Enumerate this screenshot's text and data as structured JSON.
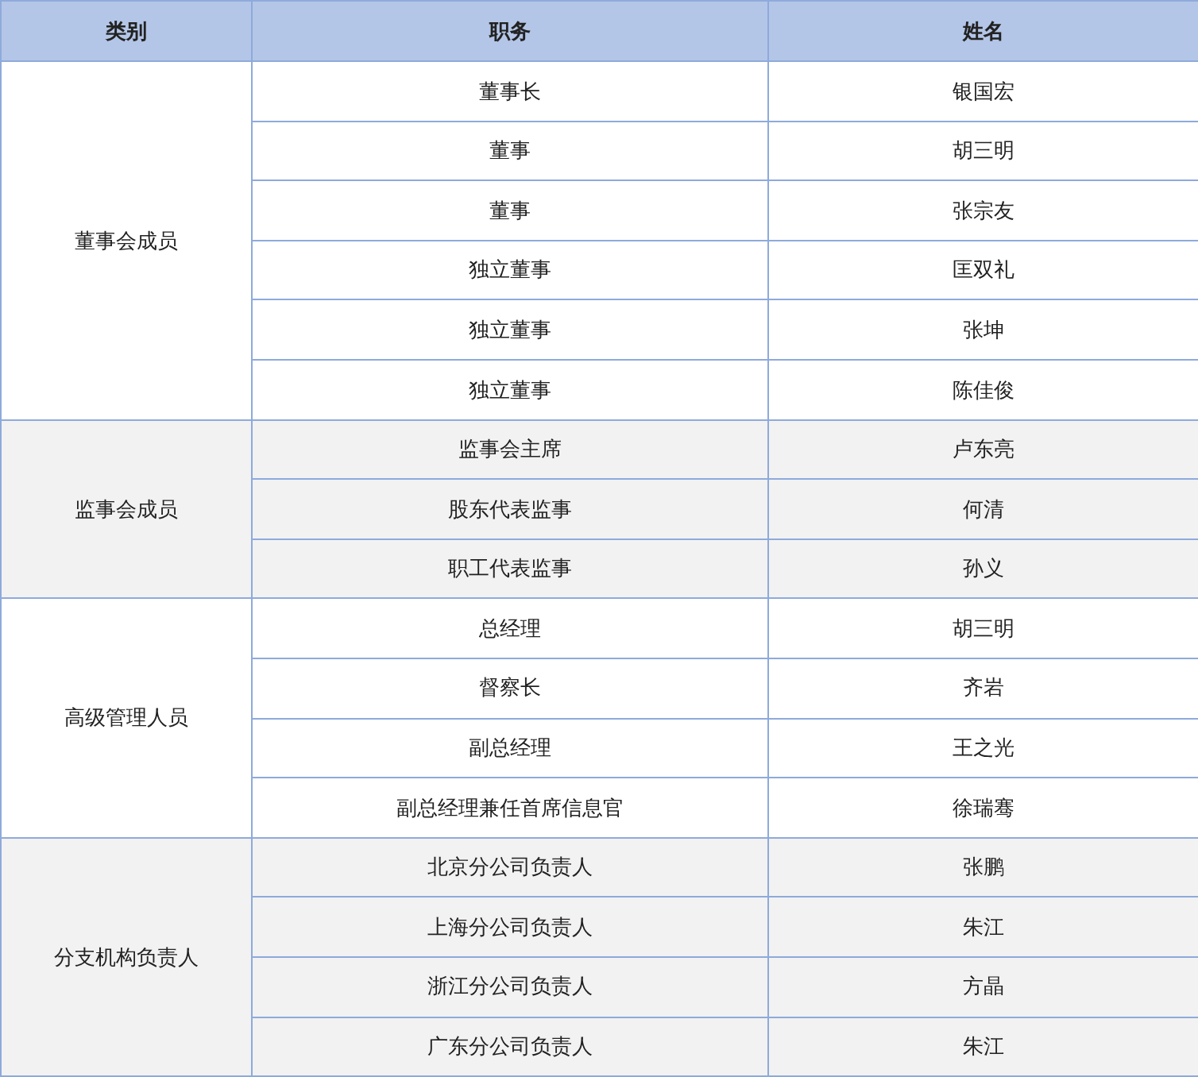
{
  "table": {
    "columns": [
      "类别",
      "职务",
      "姓名"
    ],
    "groups": [
      {
        "category": "董事会成员",
        "shaded": false,
        "rows": [
          {
            "position": "董事长",
            "name": "银国宏"
          },
          {
            "position": "董事",
            "name": "胡三明"
          },
          {
            "position": "董事",
            "name": "张宗友"
          },
          {
            "position": "独立董事",
            "name": "匡双礼"
          },
          {
            "position": "独立董事",
            "name": "张坤"
          },
          {
            "position": "独立董事",
            "name": "陈佳俊"
          }
        ]
      },
      {
        "category": "监事会成员",
        "shaded": true,
        "rows": [
          {
            "position": "监事会主席",
            "name": "卢东亮"
          },
          {
            "position": "股东代表监事",
            "name": "何清"
          },
          {
            "position": "职工代表监事",
            "name": "孙义"
          }
        ]
      },
      {
        "category": "高级管理人员",
        "shaded": false,
        "rows": [
          {
            "position": "总经理",
            "name": "胡三明"
          },
          {
            "position": "督察长",
            "name": "齐岩"
          },
          {
            "position": "副总经理",
            "name": "王之光"
          },
          {
            "position": "副总经理兼任首席信息官",
            "name": "徐瑞骞"
          }
        ]
      },
      {
        "category": "分支机构负责人",
        "shaded": true,
        "rows": [
          {
            "position": "北京分公司负责人",
            "name": "张鹏"
          },
          {
            "position": "上海分公司负责人",
            "name": "朱江"
          },
          {
            "position": "浙江分公司负责人",
            "name": "方晶"
          },
          {
            "position": "广东分公司负责人",
            "name": "朱江"
          }
        ]
      }
    ]
  }
}
